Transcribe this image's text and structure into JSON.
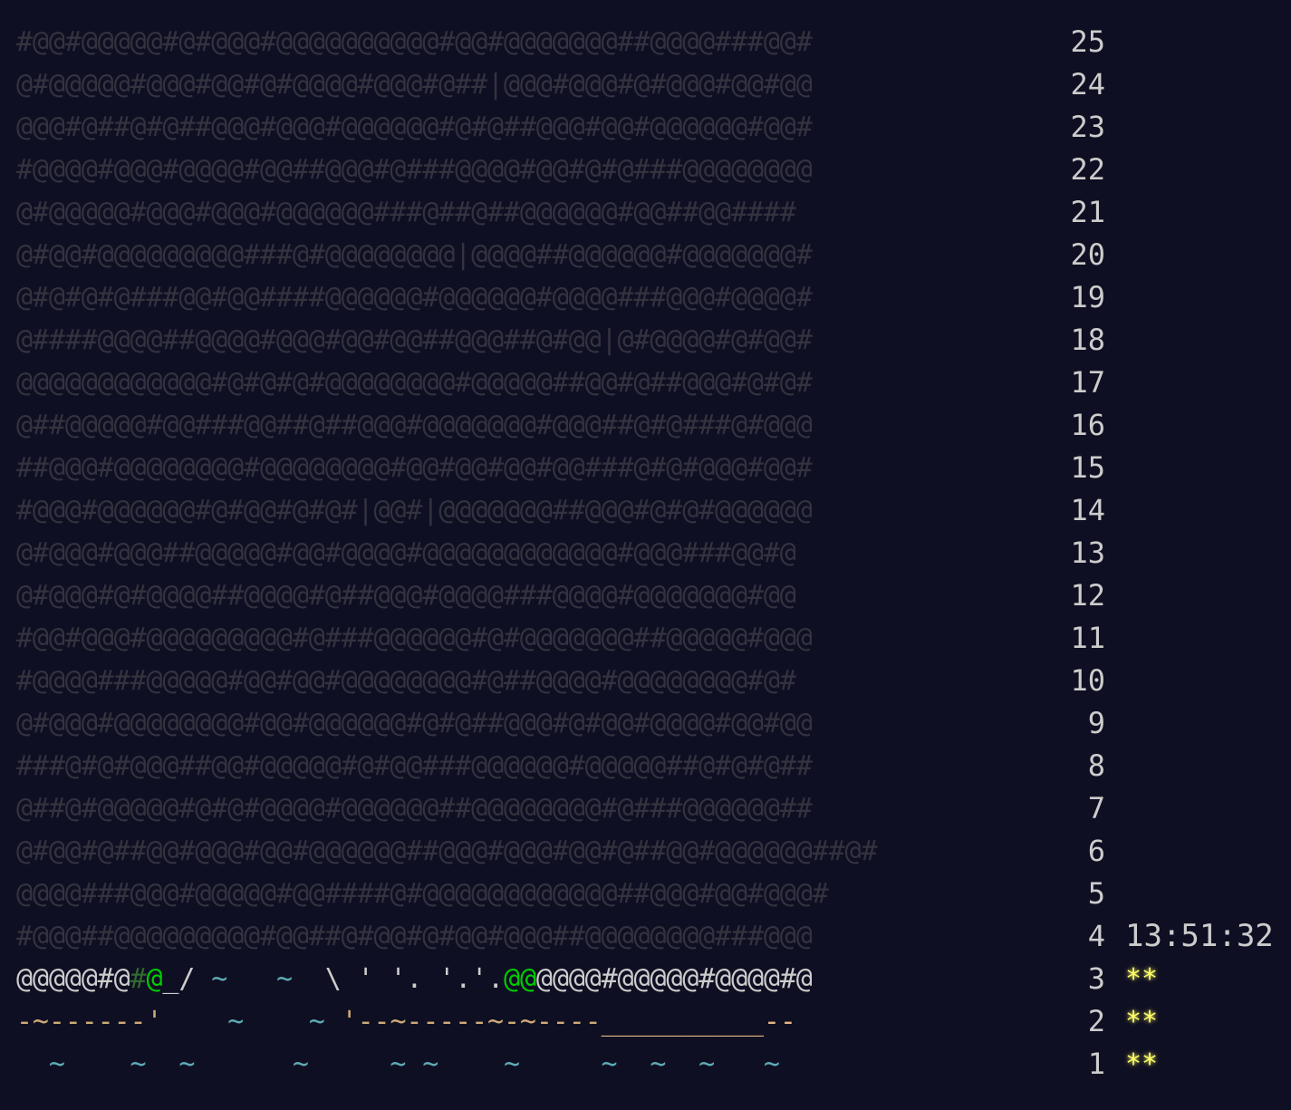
{
  "colors": {
    "background": "#0f0f23",
    "dim": "#333340",
    "bright": "#cccccc",
    "star": "#ffff66",
    "green": "#00cc00",
    "dark_green": "#2f6b2f",
    "water": "#5eabb5",
    "sand": "#ccaa77",
    "beach": "#e3b585"
  },
  "calendar": [
    {
      "day": "25",
      "segments": [
        {
          "text": "#@@#@@@@@#@#@@@#@@@@@@@@@@#@@#@@@@@@@##@@@@###@@#",
          "color": "dim"
        }
      ]
    },
    {
      "day": "24",
      "segments": [
        {
          "text": "@#@@@@@#@@@#@@#@#@@@@#@@@#@##|@@@#@@@#@#@@@#@@#@@",
          "color": "dim"
        }
      ]
    },
    {
      "day": "23",
      "segments": [
        {
          "text": "@@@#@##@#@##@@@#@@@#@@@@@@#@#@##@@@#@@#@@@@@@#@@#",
          "color": "dim"
        }
      ]
    },
    {
      "day": "22",
      "segments": [
        {
          "text": "#@@@@#@@@#@@@@#@@##@@@#@###@@@@#@@#@#@###@@@@@@@@",
          "color": "dim"
        }
      ]
    },
    {
      "day": "21",
      "segments": [
        {
          "text": "@#@@@@@#@@@#@@@#@@@@@@###@##@##@@@@@@#@@##@@####",
          "color": "dim"
        }
      ]
    },
    {
      "day": "20",
      "segments": [
        {
          "text": "@#@@#@@@@@@@@@###@#@@@@@@@@|@@@@##@@@@@@#@@@@@@@#",
          "color": "dim"
        }
      ]
    },
    {
      "day": "19",
      "segments": [
        {
          "text": "@#@#@#@###@@#@@####@@@@@@#@@@@@@#@@@@###@@@#@@@@#",
          "color": "dim"
        }
      ]
    },
    {
      "day": "18",
      "segments": [
        {
          "text": "@####@@@@##@@@@#@@@#@@#@@##@@@##@#@@|@#@@@@#@#@@#",
          "color": "dim"
        }
      ]
    },
    {
      "day": "17",
      "segments": [
        {
          "text": "@@@@@@@@@@@@#@#@#@#@@@@@@@@#@@@@@##@@#@##@@@#@#@#",
          "color": "dim"
        }
      ]
    },
    {
      "day": "16",
      "segments": [
        {
          "text": "@##@@@@@#@@###@@##@##@@@#@@@@@@@#@@@##@#@###@#@@@",
          "color": "dim"
        }
      ]
    },
    {
      "day": "15",
      "segments": [
        {
          "text": "##@@@#@@@@@@@@#@@@@@@@@#@@#@@#@@#@@###@#@#@@@#@@#",
          "color": "dim"
        }
      ]
    },
    {
      "day": "14",
      "segments": [
        {
          "text": "#@@@#@@@@@@#@#@@#@#@#|@@#|@@@@@@@##@@@#@#@#@@@@@@",
          "color": "dim"
        }
      ]
    },
    {
      "day": "13",
      "segments": [
        {
          "text": "@#@@@#@@@##@@@@@#@@#@@@@#@@@@@@@@@@@@#@@@###@@#@",
          "color": "dim"
        }
      ]
    },
    {
      "day": "12",
      "segments": [
        {
          "text": "@#@@@#@#@@@@##@@@@#@##@@@#@@@@###@@@@#@@@@@@@#@@",
          "color": "dim"
        }
      ]
    },
    {
      "day": "11",
      "segments": [
        {
          "text": "#@@#@@@#@@@@@@@@@#@###@@@@@@#@#@@@@@@@##@@@@@#@@@",
          "color": "dim"
        }
      ]
    },
    {
      "day": "10",
      "segments": [
        {
          "text": "#@@@@###@@@@@#@@#@@#@@@@@@@@#@##@@@@#@@@@@@@@#@#",
          "color": "dim"
        }
      ]
    },
    {
      "day": "9",
      "segments": [
        {
          "text": "@#@@@#@@@@@@@@#@@#@@@@@@#@#@##@@@#@#@@#@@@@#@@#@@",
          "color": "dim"
        }
      ]
    },
    {
      "day": "8",
      "segments": [
        {
          "text": "###@#@#@@@##@@#@@@@@#@#@@###@@@@@@#@@@@@##@#@#@##",
          "color": "dim"
        }
      ]
    },
    {
      "day": "7",
      "segments": [
        {
          "text": "@##@#@@@@@#@#@#@@@@#@@@@@@##@@@@@@@@#@###@@@@@@##",
          "color": "dim"
        }
      ]
    },
    {
      "day": "6",
      "segments": [
        {
          "text": "@#@@#@##@@#@@@#@@#@@@@@@##@@@#@@@#@@#@##@@#@@@@@@##@#",
          "color": "dim"
        }
      ]
    },
    {
      "day": "5",
      "segments": [
        {
          "text": "@@@@###@@@#@@@@@#@@####@#@@@@@@@@@@@@##@@@#@@#@@@#",
          "color": "dim"
        }
      ]
    },
    {
      "day": "4",
      "timer": "13:51:32",
      "segments": [
        {
          "text": "#@@@##@@@@@@@@@#@@##@#@@#@#@@#@@@##@@@@@@@@###@@@",
          "color": "dim"
        }
      ]
    },
    {
      "day": "3",
      "stars": "**",
      "segments": [
        {
          "text": "@@@@@#@",
          "color": "bright"
        },
        {
          "text": "#",
          "color": "dark_green"
        },
        {
          "text": "@",
          "color": "green"
        },
        {
          "text": "_/",
          "color": "bright"
        },
        {
          "text": " ~",
          "color": "water"
        },
        {
          "text": "   ",
          "color": "dim"
        },
        {
          "text": "~",
          "color": "water"
        },
        {
          "text": "  ",
          "color": "dim"
        },
        {
          "text": "\\ ' '. '.'.",
          "color": "bright"
        },
        {
          "text": "@@",
          "color": "green"
        },
        {
          "text": "@@@@#@@@@@#@@@@#@",
          "color": "bright"
        }
      ]
    },
    {
      "day": "2",
      "stars": "**",
      "segments": [
        {
          "text": "-~------'",
          "color": "sand"
        },
        {
          "text": "    ",
          "color": "dim"
        },
        {
          "text": "~",
          "color": "water"
        },
        {
          "text": "    ",
          "color": "dim"
        },
        {
          "text": "~",
          "color": "water"
        },
        {
          "text": " '--~-----~-~----",
          "color": "sand"
        },
        {
          "text": "__________--",
          "color": "beach"
        }
      ]
    },
    {
      "day": "1",
      "stars": "**",
      "segments": [
        {
          "text": "  ~    ~  ~      ~     ~ ~    ~     ~  ~  ~   ~",
          "color": "water"
        }
      ]
    }
  ]
}
